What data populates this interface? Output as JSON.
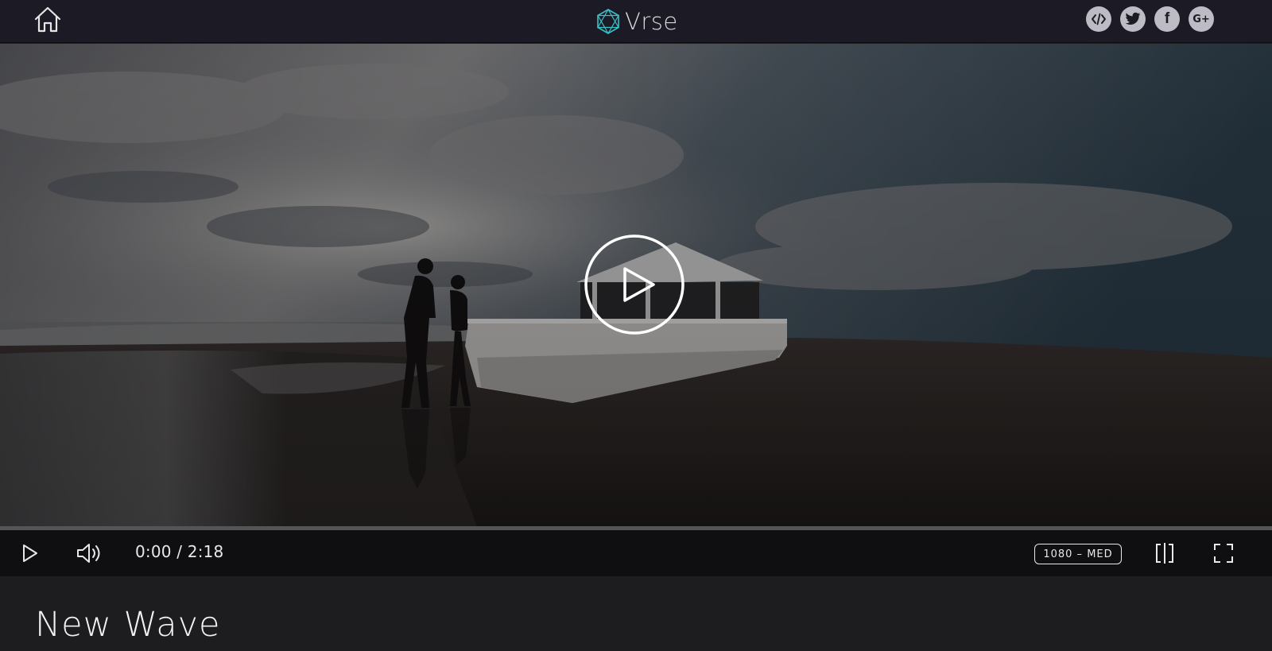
{
  "header": {
    "home_icon": "home-icon",
    "brand_name": "Vrse",
    "brand_icon": "hexagon-logo-icon",
    "brand_color": "#3bc1c7",
    "social": [
      {
        "name": "embed",
        "icon": "code-icon",
        "glyph": "</>"
      },
      {
        "name": "twitter",
        "icon": "twitter-icon",
        "glyph": ""
      },
      {
        "name": "facebook",
        "icon": "facebook-icon",
        "glyph": "f"
      },
      {
        "name": "google-plus",
        "icon": "google-plus-icon",
        "glyph": "G+"
      }
    ]
  },
  "player": {
    "big_play_icon": "play-circle-icon",
    "progress": 0,
    "controls": {
      "play_icon": "play-icon",
      "volume_icon": "volume-icon",
      "time": "0:00 / 2:18",
      "quality": "1080 – MED",
      "split_icon": "split-view-icon",
      "fullscreen_icon": "fullscreen-icon"
    }
  },
  "video": {
    "title": "New Wave"
  }
}
